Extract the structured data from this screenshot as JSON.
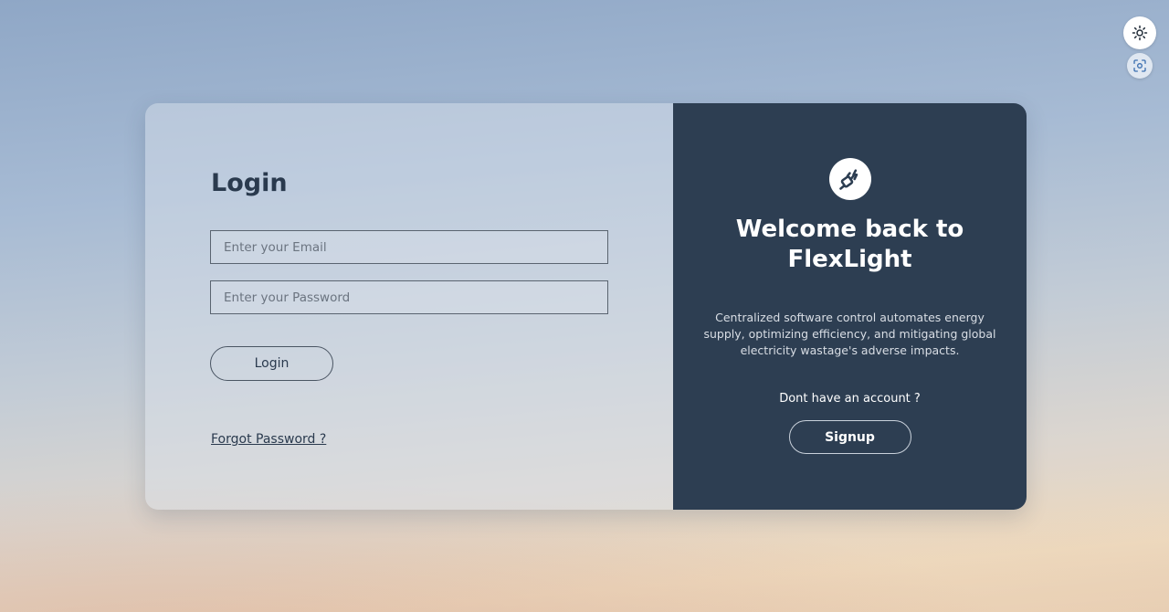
{
  "login": {
    "title": "Login",
    "email_placeholder": "Enter your Email",
    "password_placeholder": "Enter your Password",
    "button_label": "Login",
    "forgot_label": "Forgot Password ?"
  },
  "welcome": {
    "logo_icon": "plug-icon",
    "title": "Welcome back to FlexLight",
    "description": "Centralized software control automates energy supply, optimizing efficiency, and mitigating global electricity wastage's adverse impacts.",
    "no_account_text": "Dont have an account ?",
    "signup_label": "Signup"
  },
  "controls": {
    "theme_icon": "sun-icon",
    "capture_icon": "screenshot-icon"
  },
  "colors": {
    "panel_dark": "#2d3e52",
    "text_dark": "#2a3a4e"
  }
}
